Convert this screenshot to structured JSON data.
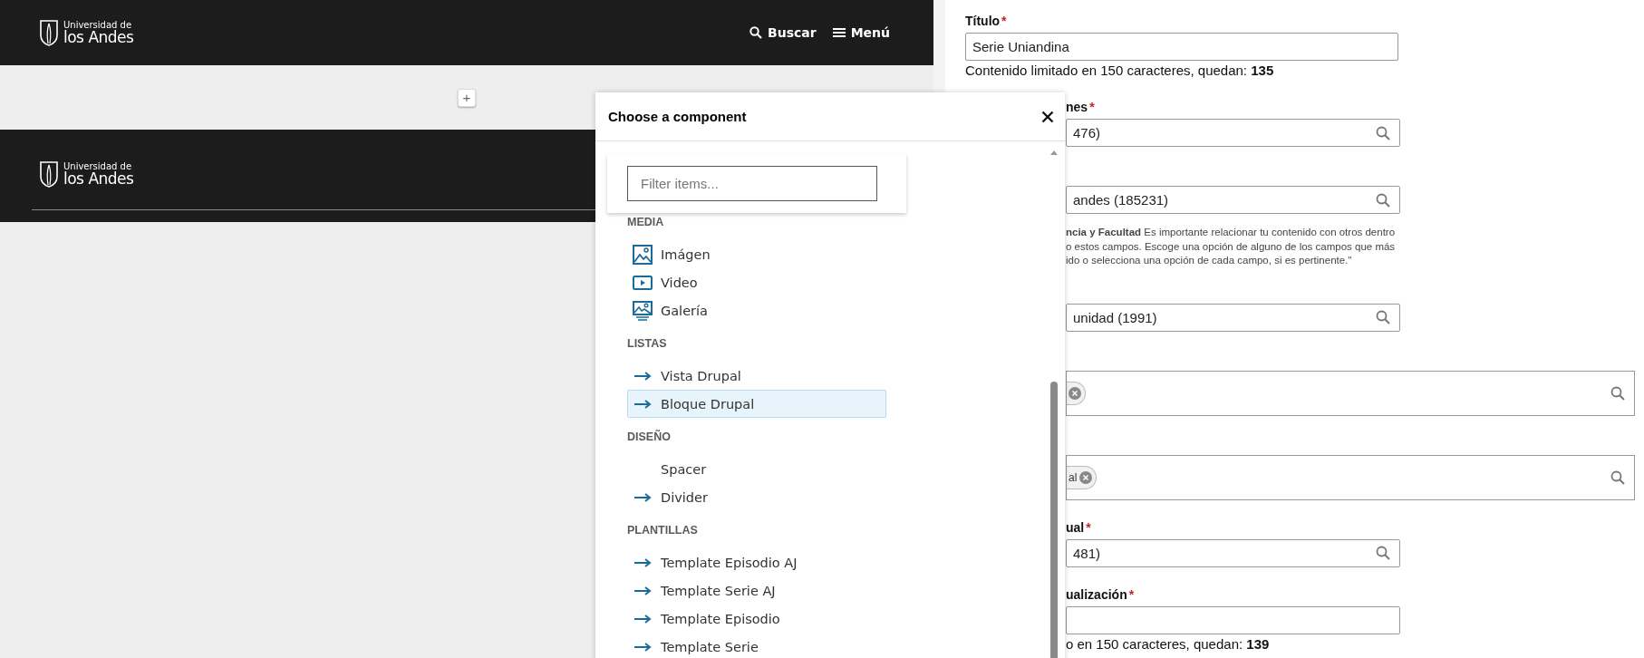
{
  "header": {
    "logo": {
      "line1": "Universidad de",
      "line2": "los Andes"
    },
    "actions": [
      {
        "label": "Buscar",
        "kind": "search"
      },
      {
        "label": "Menú",
        "kind": "menu"
      }
    ]
  },
  "add_button": {
    "label": "+"
  },
  "footer": {
    "logo": {
      "line1": "Universidad de",
      "line2": "los Andes"
    }
  },
  "modal": {
    "title": "Choose a component",
    "filter": {
      "placeholder": "Filter items..."
    },
    "groups": [
      {
        "title": "MEDIA",
        "items": [
          {
            "label": "Imágen",
            "kind": "image",
            "selected": false
          },
          {
            "label": "Video",
            "kind": "video",
            "selected": false
          },
          {
            "label": "Galería",
            "kind": "gallery",
            "selected": false
          }
        ]
      },
      {
        "title": "LISTAS",
        "items": [
          {
            "label": "Vista Drupal",
            "kind": "arrow",
            "selected": false
          },
          {
            "label": "Bloque Drupal",
            "kind": "arrow",
            "selected": true
          }
        ]
      },
      {
        "title": "DISEÑO",
        "items": [
          {
            "label": "Spacer",
            "kind": "plain",
            "selected": false
          },
          {
            "label": "Divider",
            "kind": "arrow",
            "selected": false
          }
        ]
      },
      {
        "title": "PLANTILLAS",
        "items": [
          {
            "label": "Template Episodio AJ",
            "kind": "arrow",
            "selected": false
          },
          {
            "label": "Template Serie AJ",
            "kind": "arrow",
            "selected": false
          },
          {
            "label": "Template Episodio",
            "kind": "arrow",
            "selected": false
          },
          {
            "label": "Template Serie",
            "kind": "arrow",
            "selected": false
          }
        ]
      }
    ]
  },
  "form": {
    "fields": [
      {
        "kind": "text",
        "label": "Título",
        "required_mark": "*",
        "value": "Serie Uniandina",
        "help": "Contenido limitado en 150 caracteres, quedan: **135**"
      },
      {
        "kind": "search",
        "label": "nes",
        "required_mark": "*",
        "value": "476)"
      },
      {
        "kind": "search",
        "value": "andes (185231)"
      },
      {
        "kind": "note",
        "lines": [
          "**ncia y Facultad** Es importante relacionar tu contenido con otros dentro",
          "o estos campos. Escoge una opción de alguno de los campos que más",
          "ido o selecciona una opción de cada campo, si es pertinente.\""
        ]
      },
      {
        "kind": "search",
        "value": "unidad (1991)"
      },
      {
        "kind": "tags",
        "chips": [
          {
            "kind": "remove-only"
          }
        ]
      },
      {
        "kind": "tags",
        "chips": [
          {
            "kind": "labeled",
            "label": "al"
          }
        ]
      },
      {
        "kind": "search",
        "label": "ual",
        "required_mark": "*",
        "value": "481)"
      },
      {
        "kind": "text",
        "label": "ualización",
        "required_mark": "*",
        "help": "o en 150 caracteres, quedan: **139**"
      }
    ]
  }
}
